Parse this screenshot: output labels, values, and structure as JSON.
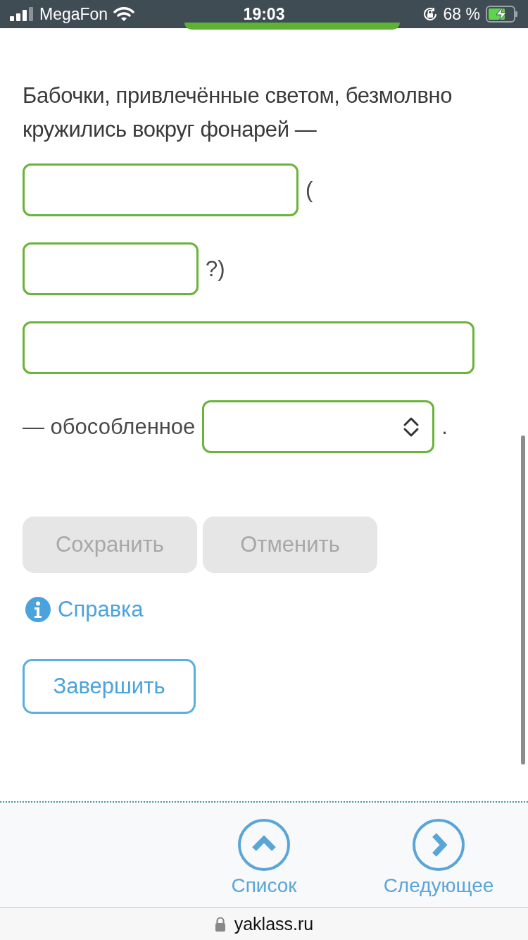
{
  "status_bar": {
    "carrier": "MegaFon",
    "time": "19:03",
    "battery": "68 %"
  },
  "question": {
    "text": "Бабочки, привлечённые светом, безмолвно кружились вокруг фонарей —",
    "blanks": [
      {
        "kind": "input",
        "after": "("
      },
      {
        "kind": "input",
        "after": "?)"
      },
      {
        "kind": "input"
      },
      {
        "kind": "select",
        "before": "— обособленное",
        "after": "."
      }
    ]
  },
  "buttons": [
    {
      "label": "Сохранить",
      "disabled": true
    },
    {
      "label": "Отменить",
      "disabled": true
    }
  ],
  "help_link": "Справка",
  "finish_button": "Завершить",
  "nav": [
    {
      "label": "Список",
      "kind": "up"
    },
    {
      "label": "Следующее",
      "kind": "next"
    }
  ],
  "address_bar": {
    "url": "yaklass.ru"
  }
}
